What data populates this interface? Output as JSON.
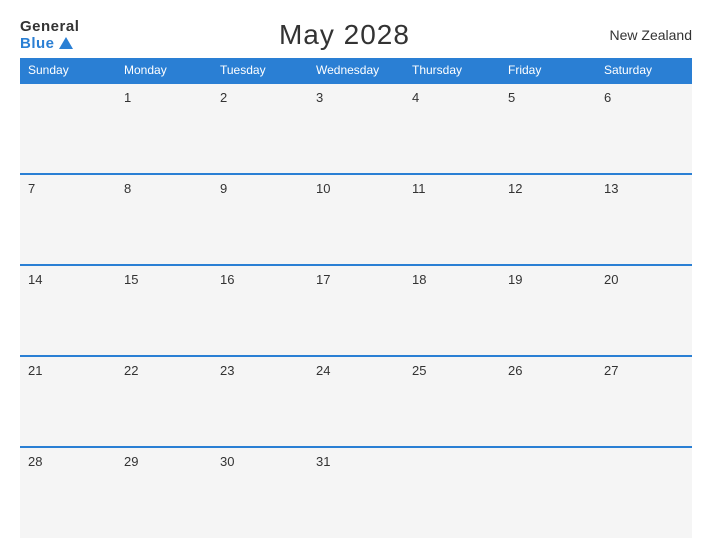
{
  "logo": {
    "general": "General",
    "blue": "Blue"
  },
  "title": "May 2028",
  "country": "New Zealand",
  "days_of_week": [
    "Sunday",
    "Monday",
    "Tuesday",
    "Wednesday",
    "Thursday",
    "Friday",
    "Saturday"
  ],
  "weeks": [
    [
      "",
      "1",
      "2",
      "3",
      "4",
      "5",
      "6"
    ],
    [
      "7",
      "8",
      "9",
      "10",
      "11",
      "12",
      "13"
    ],
    [
      "14",
      "15",
      "16",
      "17",
      "18",
      "19",
      "20"
    ],
    [
      "21",
      "22",
      "23",
      "24",
      "25",
      "26",
      "27"
    ],
    [
      "28",
      "29",
      "30",
      "31",
      "",
      "",
      ""
    ]
  ]
}
